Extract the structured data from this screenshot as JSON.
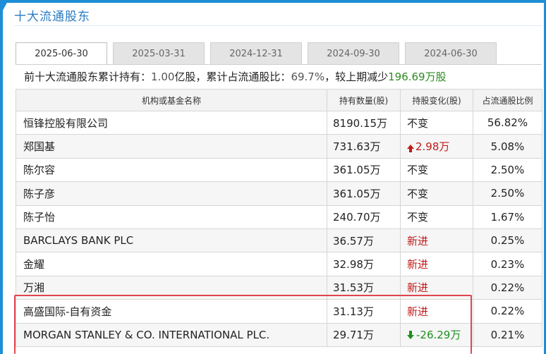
{
  "section_title": "十大流通股东",
  "tabs": [
    "2025-06-30",
    "2025-03-31",
    "2024-12-31",
    "2024-09-30",
    "2024-06-30"
  ],
  "active_tab": "2025-06-30",
  "summary": {
    "prefix": "前十大流通股东累计持有：",
    "shares": "1.00",
    "mid": "亿股，累计占流通股比：",
    "ratio": "69.7%",
    "suffix": "，较上期减少",
    "change": "196.69万股"
  },
  "table": {
    "headers": [
      "机构或基金名称",
      "持有数量(股)",
      "持股变化(股)",
      "占流通股比例"
    ],
    "rows": [
      {
        "name": "恒锋控股有限公司",
        "holding": "8190.15万",
        "change": "不变",
        "change_type": "same",
        "pct": "56.82%"
      },
      {
        "name": "郑国基",
        "holding": "731.63万",
        "change": "2.98万",
        "change_type": "up",
        "pct": "5.08%"
      },
      {
        "name": "陈尔容",
        "holding": "361.05万",
        "change": "不变",
        "change_type": "same",
        "pct": "2.50%"
      },
      {
        "name": "陈子彦",
        "holding": "361.05万",
        "change": "不变",
        "change_type": "same",
        "pct": "2.50%"
      },
      {
        "name": "陈子怡",
        "holding": "240.70万",
        "change": "不变",
        "change_type": "same",
        "pct": "1.67%"
      },
      {
        "name": "BARCLAYS BANK PLC",
        "holding": "36.57万",
        "change": "新进",
        "change_type": "new",
        "pct": "0.25%"
      },
      {
        "name": "金耀",
        "holding": "32.98万",
        "change": "新进",
        "change_type": "new",
        "pct": "0.23%"
      },
      {
        "name": "万湘",
        "holding": "31.53万",
        "change": "新进",
        "change_type": "new",
        "pct": "0.22%"
      },
      {
        "name": "高盛国际-自有资金",
        "holding": "31.13万",
        "change": "新进",
        "change_type": "new",
        "pct": "0.22%"
      },
      {
        "name": "MORGAN STANLEY & CO. INTERNATIONAL PLC.",
        "holding": "29.71万",
        "change": "-26.29万",
        "change_type": "down",
        "pct": "0.21%"
      }
    ]
  },
  "colors": {
    "accent": "#1e8ed6",
    "up": "#c21a1a",
    "down": "#1e8f1e",
    "highlight": "#e0454f"
  }
}
